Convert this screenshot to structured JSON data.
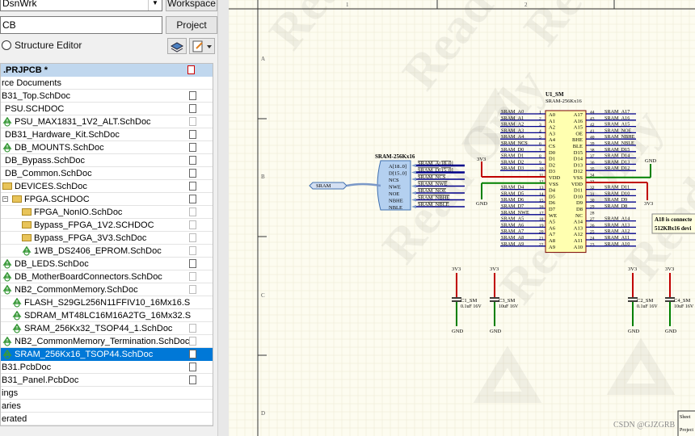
{
  "panel": {
    "workspace_combo_value": "DsnWrk",
    "workspace_button": "Workspace",
    "project_input_value": "CB",
    "project_button": "Project",
    "structure_editor_label": "Structure Editor",
    "project_header": ".PRJPCB *",
    "tree_rows": [
      {
        "text": "rce Documents"
      },
      {
        "text": "B31_Top.SchDoc"
      },
      {
        "text": "PSU.SCHDOC"
      },
      {
        "text": "PSU_MAX1831_1V2_ALT.SchDoc"
      },
      {
        "text": "DB31_Hardware_Kit.SchDoc"
      },
      {
        "text": "DB_MOUNTS.SchDoc"
      },
      {
        "text": "DB_Bypass.SchDoc"
      },
      {
        "text": "DB_Common.SchDoc"
      },
      {
        "text": "DEVICES.SchDoc"
      },
      {
        "text": "FPGA.SCHDOC"
      },
      {
        "text": "FPGA_NonIO.SchDoc"
      },
      {
        "text": "Bypass_FPGA_1V2.SCHDOC"
      },
      {
        "text": "Bypass_FPGA_3V3.SchDoc"
      },
      {
        "text": "1WB_DS2406_EPROM.SchDoc"
      },
      {
        "text": "DB_LEDS.SchDoc"
      },
      {
        "text": "DB_MotherBoardConnectors.SchDoc"
      },
      {
        "text": "NB2_CommonMemory.SchDoc"
      },
      {
        "text": "FLASH_S29GL256N11FFIV10_16Mx16.S"
      },
      {
        "text": "SDRAM_MT48LC16M16A2TG_16Mx32.S"
      },
      {
        "text": "SRAM_256Kx32_TSOP44_1.SchDoc"
      },
      {
        "text": "NB2_CommonMemory_Termination.SchDoc"
      },
      {
        "text": "SRAM_256Kx16_TSOP44.SchDoc"
      },
      {
        "text": "B31.PcbDoc"
      },
      {
        "text": "B31_Panel.PcbDoc"
      },
      {
        "text": "ings"
      },
      {
        "text": "aries"
      },
      {
        "text": "erated"
      }
    ]
  },
  "schematic": {
    "watermark": "Read Only",
    "zone_numbers": [
      "1",
      "2"
    ],
    "zone_letters": [
      "A",
      "B",
      "C",
      "D"
    ],
    "sheet_symbol_title": "SRAM-256Kx16",
    "sheet_entries": [
      "A[18..0]",
      "D[15..0]",
      "NCS",
      "NWE",
      "NOE",
      "NBHE",
      "NBLE"
    ],
    "sheet_nets": [
      "SRAM_A[18..0]",
      "SRAM_D[15..0]",
      "SRAM_NCS",
      "SRAM_NWE",
      "SRAM_NOE",
      "SRAM_NBHE",
      "SRAM_NBLE"
    ],
    "port_label": "SRAM",
    "ic_designator": "U1_SM",
    "ic_part": "SRAM-256Kx16",
    "left_pin_names": [
      "A0",
      "A1",
      "A2",
      "A3",
      "A4",
      "CS",
      "D0",
      "D1",
      "D2",
      "D3",
      "VDD",
      "VSS",
      "D4",
      "D5",
      "D6",
      "D7",
      "WE",
      "A5",
      "A6",
      "A7",
      "A8",
      "A9"
    ],
    "left_pin_numbers": [
      "1",
      "2",
      "3",
      "4",
      "5",
      "6",
      "7",
      "8",
      "9",
      "10",
      "11",
      "12",
      "13",
      "14",
      "15",
      "16",
      "17",
      "18",
      "19",
      "20",
      "21",
      "22"
    ],
    "right_pin_names": [
      "A17",
      "A16",
      "A15",
      "OE",
      "BHE",
      "BLE",
      "D15",
      "D14",
      "D13",
      "D12",
      "VSS",
      "VDD",
      "D11",
      "D10",
      "D9",
      "D8",
      "NC",
      "A14",
      "A13",
      "A12",
      "A11",
      "A10"
    ],
    "right_pin_numbers": [
      "44",
      "43",
      "42",
      "41",
      "40",
      "39",
      "38",
      "37",
      "36",
      "35",
      "34",
      "33",
      "32",
      "31",
      "30",
      "29",
      "28",
      "27",
      "26",
      "25",
      "24",
      "23"
    ],
    "left_nets": [
      "SRAM_A0",
      "SRAM_A1",
      "SRAM_A2",
      "SRAM_A3",
      "SRAM_A4",
      "SRAM_NCS",
      "SRAM_D0",
      "SRAM_D1",
      "SRAM_D2",
      "SRAM_D3",
      "",
      "",
      "SRAM_D4",
      "SRAM_D5",
      "SRAM_D6",
      "SRAM_D7",
      "SRAM_NWE",
      "SRAM_A5",
      "SRAM_A6",
      "SRAM_A7",
      "SRAM_A8",
      "SRAM_A9"
    ],
    "right_nets": [
      "SRAM_A17",
      "SRAM_A16",
      "SRAM_A15",
      "SRAM_NOE",
      "SRAM_NBHE",
      "SRAM_NBLE",
      "SRAM_D15",
      "SRAM_D14",
      "SRAM_D13",
      "SRAM_D12",
      "",
      "",
      "SRAM_D11",
      "SRAM_D10",
      "SRAM_D9",
      "SRAM_D8",
      "",
      "SRAM_A14",
      "SRAM_A13",
      "SRAM_A12",
      "SRAM_A11",
      "SRAM_A10"
    ],
    "power_3v3": "3V3",
    "power_gnd": "GND",
    "capacitors": [
      {
        "name": "C1_SM",
        "value": "0.1uF 16V"
      },
      {
        "name": "C3_SM",
        "value": "10uF 16V"
      },
      {
        "name": "C2_SM",
        "value": "0.1uF 16V"
      },
      {
        "name": "C4_SM",
        "value": "10uF 16V"
      }
    ],
    "note_line1": "A18 is connecte",
    "note_line2": "512KBx16 devi",
    "title_block_line1": "Sheet",
    "title_block_line2": "Project",
    "credit": "CSDN @GJZGRB"
  },
  "colors": {
    "selection": "#0078d7",
    "wire": "#00008b",
    "pin_red": "#c00000",
    "gnd_green": "#008000",
    "component_fill": "#ffffb0",
    "sheet_symbol_fill": "#b4d0f0"
  }
}
